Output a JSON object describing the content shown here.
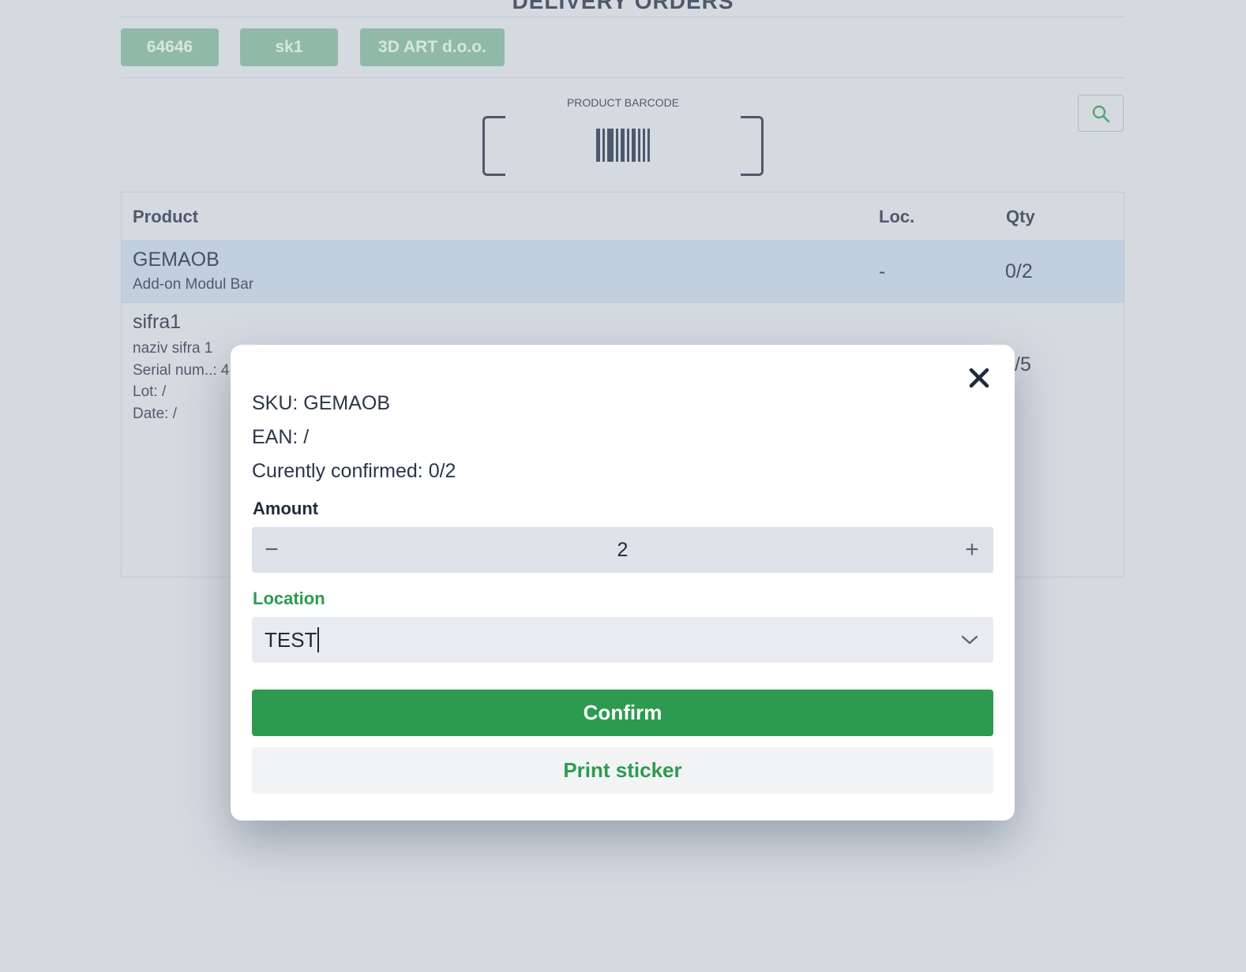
{
  "page": {
    "title": "DELIVERY ORDERS"
  },
  "tags": [
    "64646",
    "sk1",
    "3D ART d.o.o."
  ],
  "barcode": {
    "label": "PRODUCT BARCODE"
  },
  "table": {
    "headers": {
      "product": "Product",
      "location": "Loc.",
      "qty": "Qty"
    },
    "rows": [
      {
        "sku": "GEMAOB",
        "name": "Add-on Modul Bar",
        "location": "-",
        "qty": "0/2"
      },
      {
        "sku": "sifra1",
        "name": "naziv sifra 1",
        "serial": "Serial num..: 4",
        "lot": "Lot: /",
        "date": "Date: /",
        "qty_partial": "/5"
      }
    ]
  },
  "modal": {
    "sku_line": "SKU: GEMAOB",
    "ean_line": "EAN: /",
    "confirmed_line": "Curently confirmed: 0/2",
    "amount_label": "Amount",
    "amount_value": "2",
    "minus": "−",
    "plus": "+",
    "location_label": "Location",
    "location_value": "TEST",
    "confirm_label": "Confirm",
    "print_label": "Print sticker",
    "close_symbol": "✕"
  },
  "colors": {
    "accent_green": "#2c9b4f",
    "tag_green": "#82b59a",
    "selected_row": "#c3d2e3"
  }
}
